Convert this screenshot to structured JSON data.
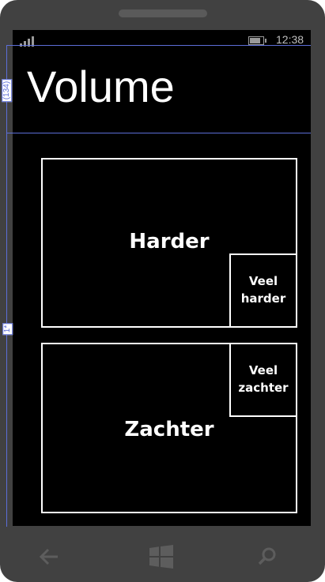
{
  "status_bar": {
    "time": "12:38",
    "battery_level": 0.8
  },
  "page": {
    "title": "Volume"
  },
  "buttons": {
    "harder": "Harder",
    "veel_harder": "Veel harder",
    "zachter": "Zachter",
    "veel_zachter": "Veel zachter"
  },
  "designer_guides": {
    "row_height_label": "(134)",
    "star_label": "1*"
  },
  "nav": {
    "back_icon": "back-arrow-icon",
    "start_icon": "windows-logo-icon",
    "search_icon": "search-icon"
  },
  "colors": {
    "background": "#000000",
    "foreground": "#ffffff",
    "chrome": "#414141",
    "guide": "#5c6ed8"
  }
}
